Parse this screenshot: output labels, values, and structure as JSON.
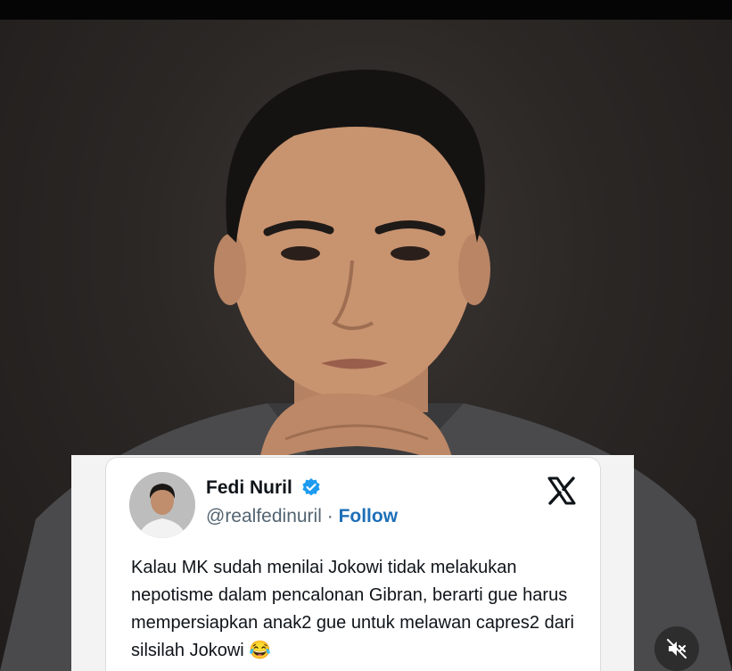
{
  "tweet": {
    "display_name": "Fedi Nuril",
    "handle": "@realfedinuril",
    "separator": " · ",
    "follow_label": "Follow",
    "text": "Kalau MK sudah menilai Jokowi tidak melakukan nepotisme dalam pencalonan Gibran, berarti gue harus mempersiapkan anak2 gue untuk melawan capres2 dari silsilah Jokowi 😂",
    "platform_icon": "x-logo-icon",
    "verified_icon": "verified-badge-icon"
  },
  "media": {
    "mute_icon": "speaker-muted-icon"
  },
  "colors": {
    "follow": "#1d6fb8",
    "verified": "#1d9bf0",
    "photo_background": "#2b2725"
  }
}
